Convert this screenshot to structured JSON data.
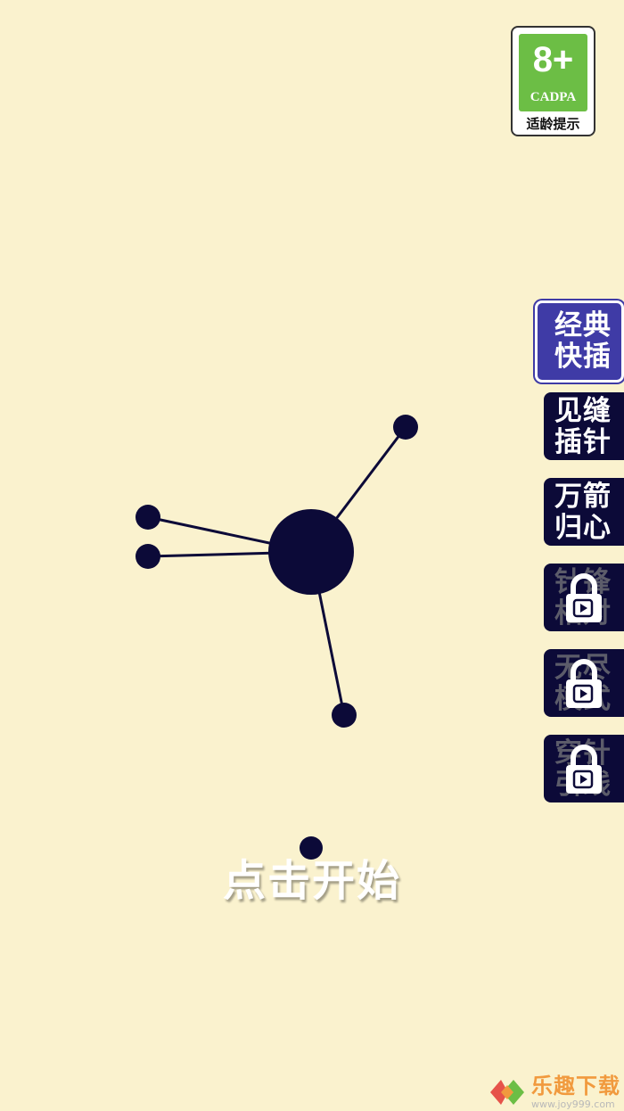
{
  "rating": {
    "age": "8+",
    "org": "CADPA",
    "hint": "适龄提示"
  },
  "modes": [
    {
      "line1": "经典",
      "line2": "快插",
      "locked": false,
      "active": true
    },
    {
      "line1": "见缝",
      "line2": "插针",
      "locked": false,
      "active": false
    },
    {
      "line1": "万箭",
      "line2": "归心",
      "locked": false,
      "active": false
    },
    {
      "line1": "针锋",
      "line2": "相对",
      "locked": true,
      "active": false
    },
    {
      "line1": "无尽",
      "line2": "模式",
      "locked": true,
      "active": false
    },
    {
      "line1": "穿针",
      "line2": "引线",
      "locked": true,
      "active": false
    }
  ],
  "game": {
    "start_label": "点击开始"
  },
  "watermark": {
    "title": "乐趣下载",
    "url": "www.joy999.com"
  },
  "colors": {
    "background": "#FAF2CE",
    "ink": "#0C0A38",
    "active_mode": "#3F3BA6",
    "rating_green": "#6CBE45"
  }
}
